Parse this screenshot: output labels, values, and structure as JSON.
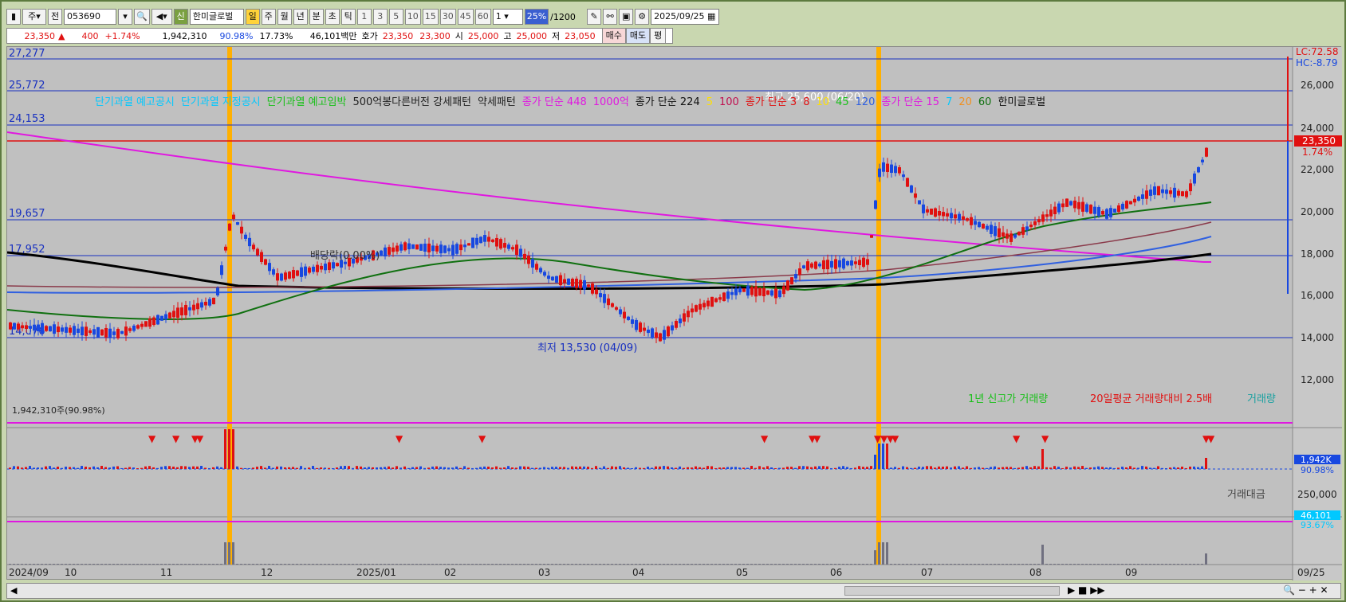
{
  "toolbar": {
    "menu_icon": "menu-icon",
    "type_select": "주",
    "prev_label": "전",
    "code": "053690",
    "stock_name": "한미글로벌",
    "badge_new": "신",
    "periods": [
      "일",
      "주",
      "월",
      "년",
      "분",
      "초",
      "틱"
    ],
    "intervals": [
      "1",
      "3",
      "5",
      "10",
      "15",
      "30",
      "45",
      "60"
    ],
    "unit_select": "1",
    "zoom_label": "25%",
    "count": "/1200",
    "date": "2025/09/25"
  },
  "quote": {
    "price": "23,350",
    "change_arrow": "▲",
    "change": "400",
    "change_pct": "+1.74%",
    "volume": "1,942,310",
    "vol_ratio": "90.98%",
    "turnover": "17.73%",
    "amount": "46,101백만",
    "ask_label": "호가",
    "ask": "23,350",
    "bid": "23,300",
    "open_label": "시",
    "open": "25,000",
    "high_label": "고",
    "high": "25,000",
    "low_label": "저",
    "low": "23,050",
    "buy": "매수",
    "sell": "매도",
    "eval": "평"
  },
  "legend": [
    {
      "text": "단기과열 예고공시",
      "color": "#00c8ff"
    },
    {
      "text": "단기과열 지정공시",
      "color": "#00c8ff"
    },
    {
      "text": "단기과열 예고임박",
      "color": "#18c018"
    },
    {
      "text": "500억봉다른버전 강세패턴",
      "color": "#222"
    },
    {
      "text": "약세패턴",
      "color": "#222"
    },
    {
      "text": "종가 단순 448",
      "color": "#e018e0"
    },
    {
      "text": "1000억",
      "color": "#e018e0"
    },
    {
      "text": "종가 단순 224",
      "color": "#111"
    },
    {
      "text": "5",
      "color": "#ffe000"
    },
    {
      "text": "100",
      "color": "#c01050"
    },
    {
      "text": "종가 단순 3",
      "color": "#e01010"
    },
    {
      "text": "8",
      "color": "#e01010"
    },
    {
      "text": "10",
      "color": "#ffe000"
    },
    {
      "text": "45",
      "color": "#18c018"
    },
    {
      "text": "120",
      "color": "#3060e0"
    },
    {
      "text": "종가 단순 15",
      "color": "#e018e0"
    },
    {
      "text": "7",
      "color": "#00c8ff"
    },
    {
      "text": "20",
      "color": "#f09020"
    },
    {
      "text": "60",
      "color": "#107010"
    },
    {
      "text": "한미글로벌",
      "color": "#111"
    }
  ],
  "left_levels": [
    "27,277",
    "25,772",
    "24,153",
    "19,657",
    "17,952",
    "14,076"
  ],
  "right_axis": [
    "26,000",
    "24,000",
    "22,000",
    "20,000",
    "18,000",
    "16,000",
    "14,000",
    "12,000"
  ],
  "lc_hc": {
    "lc": "LC:72.58",
    "hc": "HC:-8.79"
  },
  "current_price_tag": {
    "price": "23,350",
    "pct": "1.74%"
  },
  "annotations": {
    "high": "최고 25,600 (06/20)",
    "low": "최저 13,530 (04/09)",
    "dividend": "배당락(0.00%)"
  },
  "volume_panel": {
    "header": "1,942,310주(90.98%)",
    "legend": [
      {
        "text": "1년 신고가 거래량",
        "color": "#18c018"
      },
      {
        "text": "20일평균 거래량대비 2.5배",
        "color": "#e01010"
      },
      {
        "text": "거래량",
        "color": "#18a0a0"
      }
    ],
    "tag_value": "1,942K",
    "tag_pct": "90.98%"
  },
  "amount_panel": {
    "legend": "거래대금",
    "axis_label": "250,000",
    "tag_value": "46,101",
    "tag_pct": "93.67%"
  },
  "x_labels": [
    "2024/09",
    "10",
    "11",
    "12",
    "2025/01",
    "02",
    "03",
    "04",
    "05",
    "06",
    "07",
    "08",
    "09"
  ],
  "x_last": "09/25",
  "colors": {
    "up": "#e01010",
    "down": "#1848e0",
    "ma448": "#e018e0",
    "ma224": "#000000",
    "highlight": "#ffb000"
  }
}
